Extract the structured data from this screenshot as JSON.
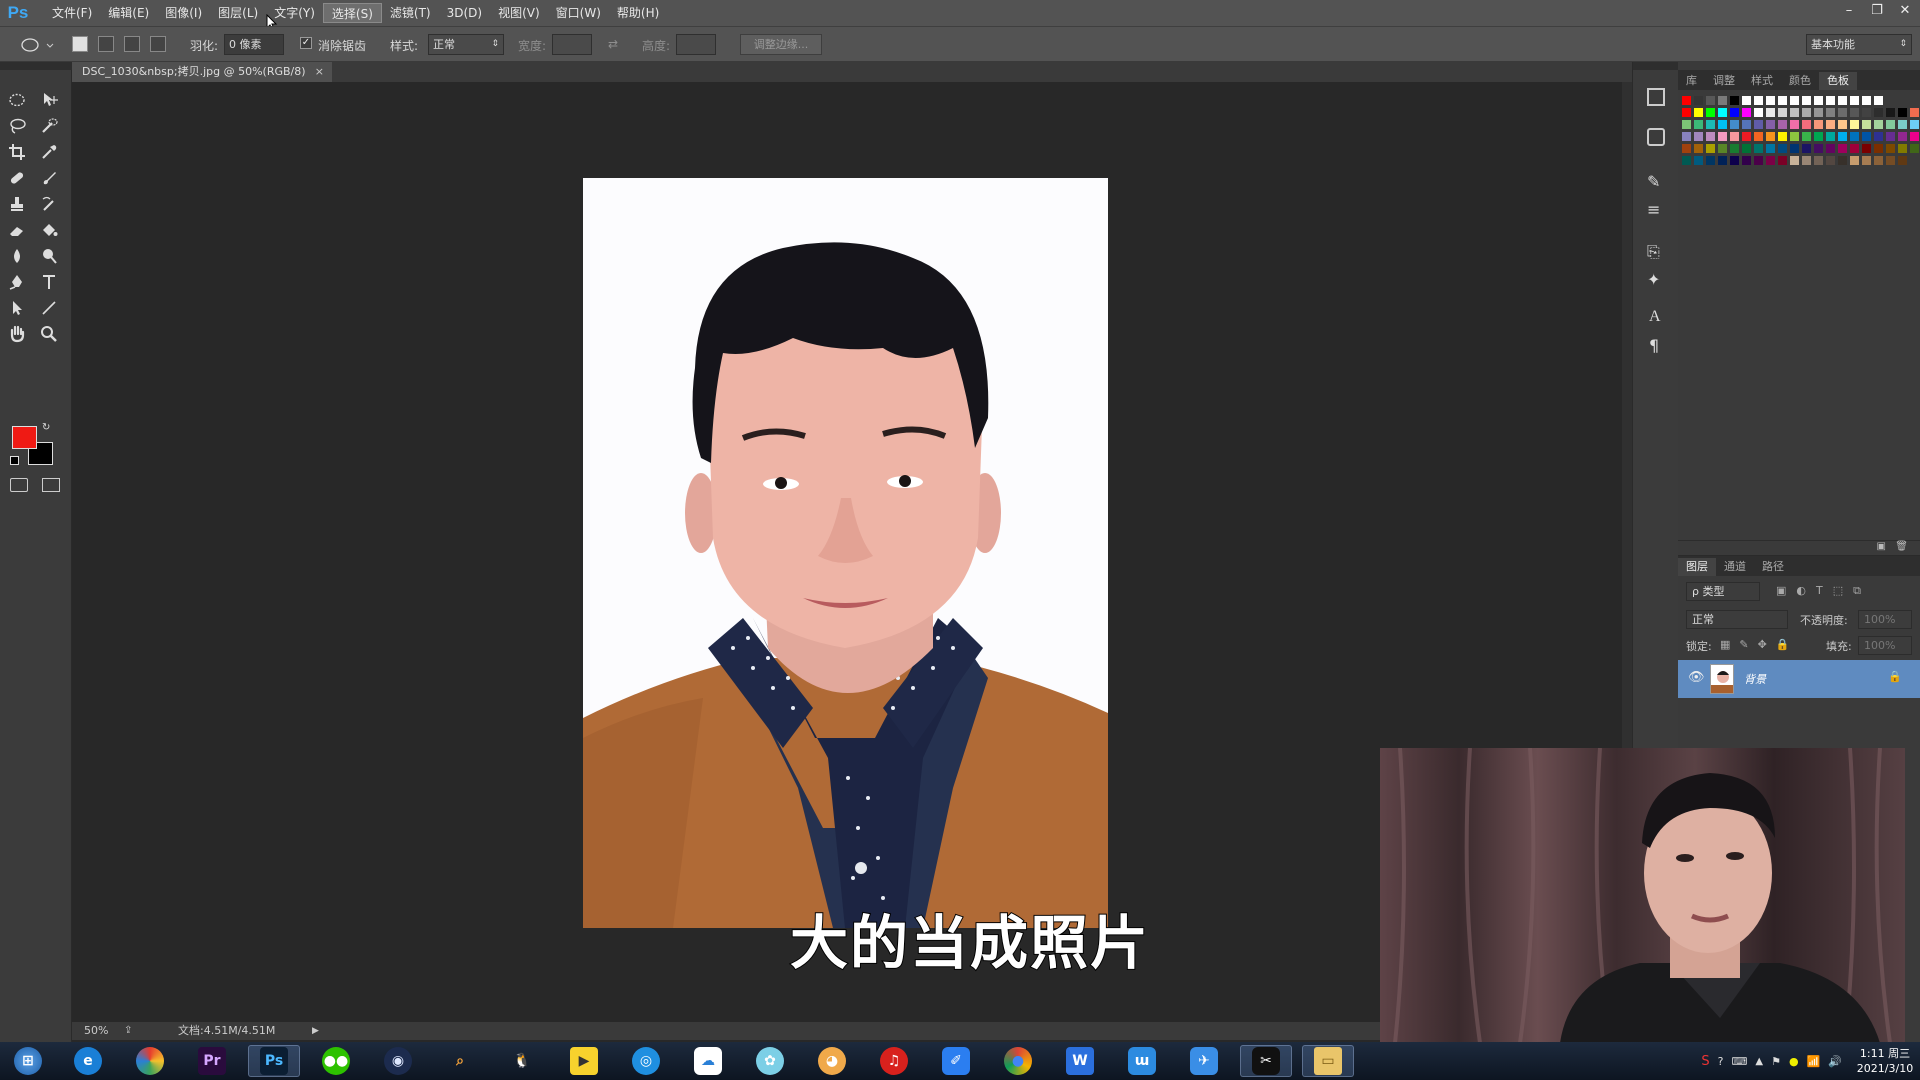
{
  "app": {
    "logo": "Ps"
  },
  "menu": [
    "文件(F)",
    "编辑(E)",
    "图像(I)",
    "图层(L)",
    "文字(Y)",
    "选择(S)",
    "滤镜(T)",
    "3D(D)",
    "视图(V)",
    "窗口(W)",
    "帮助(H)"
  ],
  "menu_active": "选择(S)",
  "options": {
    "feather_label": "羽化:",
    "feather_value": "0 像素",
    "antialias_label": "消除锯齿",
    "style_label": "样式:",
    "style_value": "正常",
    "width_label": "宽度:",
    "height_label": "高度:",
    "refine_edge": "调整边缘...",
    "workspace": "基本功能"
  },
  "document": {
    "tab_title": "DSC_1030&nbsp;拷贝.jpg @ 50%(RGB/8)",
    "close": "×"
  },
  "status": {
    "zoom": "50%",
    "doc_info": "文档:4.51M/4.51M"
  },
  "subtitle": "大的当成照片",
  "panels": {
    "top_tabs": [
      "库",
      "调整",
      "样式",
      "颜色",
      "色板"
    ],
    "top_active": "色板",
    "layers_tabs": [
      "图层",
      "通道",
      "路径"
    ],
    "layers_active": "图层",
    "kind_filter": "ρ 类型",
    "blend_mode": "正常",
    "opacity_label": "不透明度:",
    "opacity_value": "100%",
    "lock_label": "锁定:",
    "fill_label": "填充:",
    "fill_value": "100%",
    "layer_name": "背景"
  },
  "swatch_colors": [
    "#ff0000",
    "#353535",
    "#585858",
    "#7b7b7b",
    "#000000",
    "#ffffff",
    "#ffffff",
    "#ffffff",
    "#ffffff",
    "#ffffff",
    "#ffffff",
    "#ffffff",
    "#ffffff",
    "#ffffff",
    "#ffffff",
    "#ffffff",
    "#ffffff",
    "#3a3a3a",
    "#3a3a3a",
    "#3a3a3a",
    "#3a3a3a",
    "#3a3a3a",
    "#ff0000",
    "#ffff00",
    "#00ff00",
    "#00ffff",
    "#0000ff",
    "#ff00ff",
    "#ffffff",
    "#eaeaea",
    "#d5d5d5",
    "#c0c0c0",
    "#ababab",
    "#969696",
    "#818181",
    "#6c6c6c",
    "#575757",
    "#424242",
    "#2d2d2d",
    "#181818",
    "#000000",
    "#f26c4f",
    "#fbaf5d",
    "#fff568",
    "#7cc576",
    "#3bb878",
    "#1cbbb4",
    "#00bff3",
    "#438cca",
    "#5574b9",
    "#605ca8",
    "#855fa8",
    "#a763a9",
    "#f06ea9",
    "#f26d7d",
    "#f7977a",
    "#fbad82",
    "#fdc68c",
    "#fff799",
    "#c4df9b",
    "#a3d39c",
    "#82ca9c",
    "#7bcdc8",
    "#6dcff6",
    "#7da7d9",
    "#8493ca",
    "#8882be",
    "#a186be",
    "#bd8cbf",
    "#f49ac1",
    "#f5989d",
    "#ed1c24",
    "#f26522",
    "#f7941d",
    "#fff200",
    "#8dc63f",
    "#39b54a",
    "#00a651",
    "#00a99d",
    "#00aeef",
    "#0072bc",
    "#0054a6",
    "#2e3192",
    "#662d91",
    "#92278f",
    "#ec008c",
    "#ed145b",
    "#9e0b0f",
    "#a0410d",
    "#a36209",
    "#aba000",
    "#598527",
    "#197b30",
    "#007236",
    "#00746b",
    "#0076a3",
    "#004b80",
    "#003471",
    "#1b1464",
    "#440e62",
    "#630460",
    "#9e005d",
    "#9e0039",
    "#790000",
    "#7b2e00",
    "#7d4900",
    "#827b00",
    "#406618",
    "#005e20",
    "#005826",
    "#005952",
    "#005b7f",
    "#003663",
    "#002157",
    "#0d004c",
    "#32004b",
    "#4b0049",
    "#7b0046",
    "#7a0026",
    "#c7b299",
    "#998675",
    "#736357",
    "#534741",
    "#37302a",
    "#c69c6d",
    "#a67c52",
    "#8c6239",
    "#754c24",
    "#603913",
    "#3a3a3a",
    "#3a3a3a",
    "#3a3a3a"
  ],
  "taskbar": {
    "apps": [
      "start",
      "ie",
      "360browser",
      "premiere",
      "photoshop",
      "wechat",
      "cinema4d",
      "search",
      "qq",
      "player",
      "ocam",
      "baidu-netdisk",
      "flower",
      "headset",
      "netease-music",
      "feishu",
      "chrome",
      "wps-writer",
      "iqiyi-book",
      "dingtalk",
      "capcut",
      "explorer"
    ],
    "clock_time": "1:11 周三",
    "clock_date": "2021/3/10"
  }
}
